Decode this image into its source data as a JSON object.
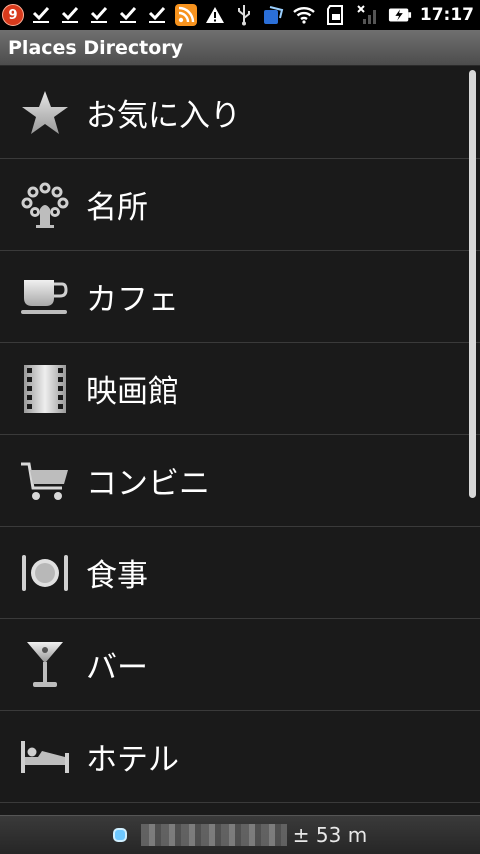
{
  "status_bar": {
    "notification_count": "9",
    "time": "17:17",
    "icons": [
      "download-done-icon",
      "download-done-icon",
      "download-done-icon",
      "download-done-icon",
      "download-done-icon",
      "rss-icon",
      "warning-icon",
      "usb-icon",
      "app-notification-icon",
      "wifi-icon",
      "sd-card-icon",
      "no-signal-icon",
      "battery-charging-icon"
    ]
  },
  "title_bar": {
    "title": "Places Directory"
  },
  "list": {
    "items": [
      {
        "label": "お気に入り",
        "icon": "star-icon"
      },
      {
        "label": "名所",
        "icon": "landmark-icon"
      },
      {
        "label": "カフェ",
        "icon": "coffee-cup-icon"
      },
      {
        "label": "映画館",
        "icon": "film-icon"
      },
      {
        "label": "コンビニ",
        "icon": "cart-icon"
      },
      {
        "label": "食事",
        "icon": "dining-icon"
      },
      {
        "label": "バー",
        "icon": "cocktail-icon"
      },
      {
        "label": "ホテル",
        "icon": "bed-icon"
      }
    ]
  },
  "footer": {
    "accuracy": "± 53 m"
  },
  "colors": {
    "title_bar": "#5e5e5e",
    "list_bg": "#1a1a1a",
    "location_dot": "#6ec8ff"
  }
}
